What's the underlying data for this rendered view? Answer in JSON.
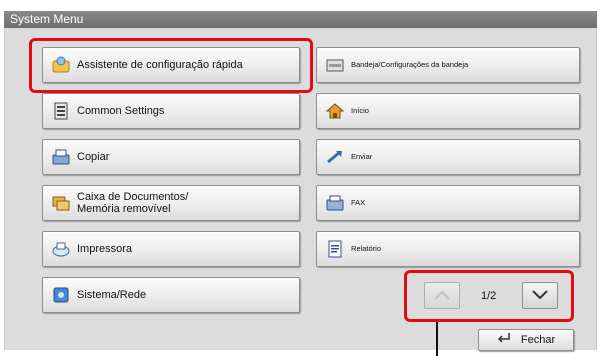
{
  "window": {
    "title": "System Menu"
  },
  "left_buttons": [
    {
      "label": "Assistente de configuração rápida",
      "icon": "wizard-icon"
    },
    {
      "label": "Common Settings",
      "icon": "settings-icon"
    },
    {
      "label": "Copiar",
      "icon": "copier-icon"
    },
    {
      "label_line1": "Caixa de Documentos/",
      "label_line2": "Memória removível",
      "icon": "folders-icon"
    },
    {
      "label": "Impressora",
      "icon": "printer-icon"
    },
    {
      "label": "Sistema/Rede",
      "icon": "network-icon"
    }
  ],
  "right_buttons": [
    {
      "label": "Bandeja/Configurações da bandeja",
      "icon": "tray-icon"
    },
    {
      "label": "Início",
      "icon": "home-icon"
    },
    {
      "label": "Enviar",
      "icon": "send-icon"
    },
    {
      "label": "FAX",
      "icon": "fax-icon"
    },
    {
      "label": "Relatório",
      "icon": "report-icon"
    }
  ],
  "pagination": {
    "page": "1/2"
  },
  "close": {
    "label": "Fechar"
  },
  "colors": {
    "highlight": "#e10a16",
    "titlebar": "#7a7a7a",
    "panel": "#dcdcdc"
  }
}
